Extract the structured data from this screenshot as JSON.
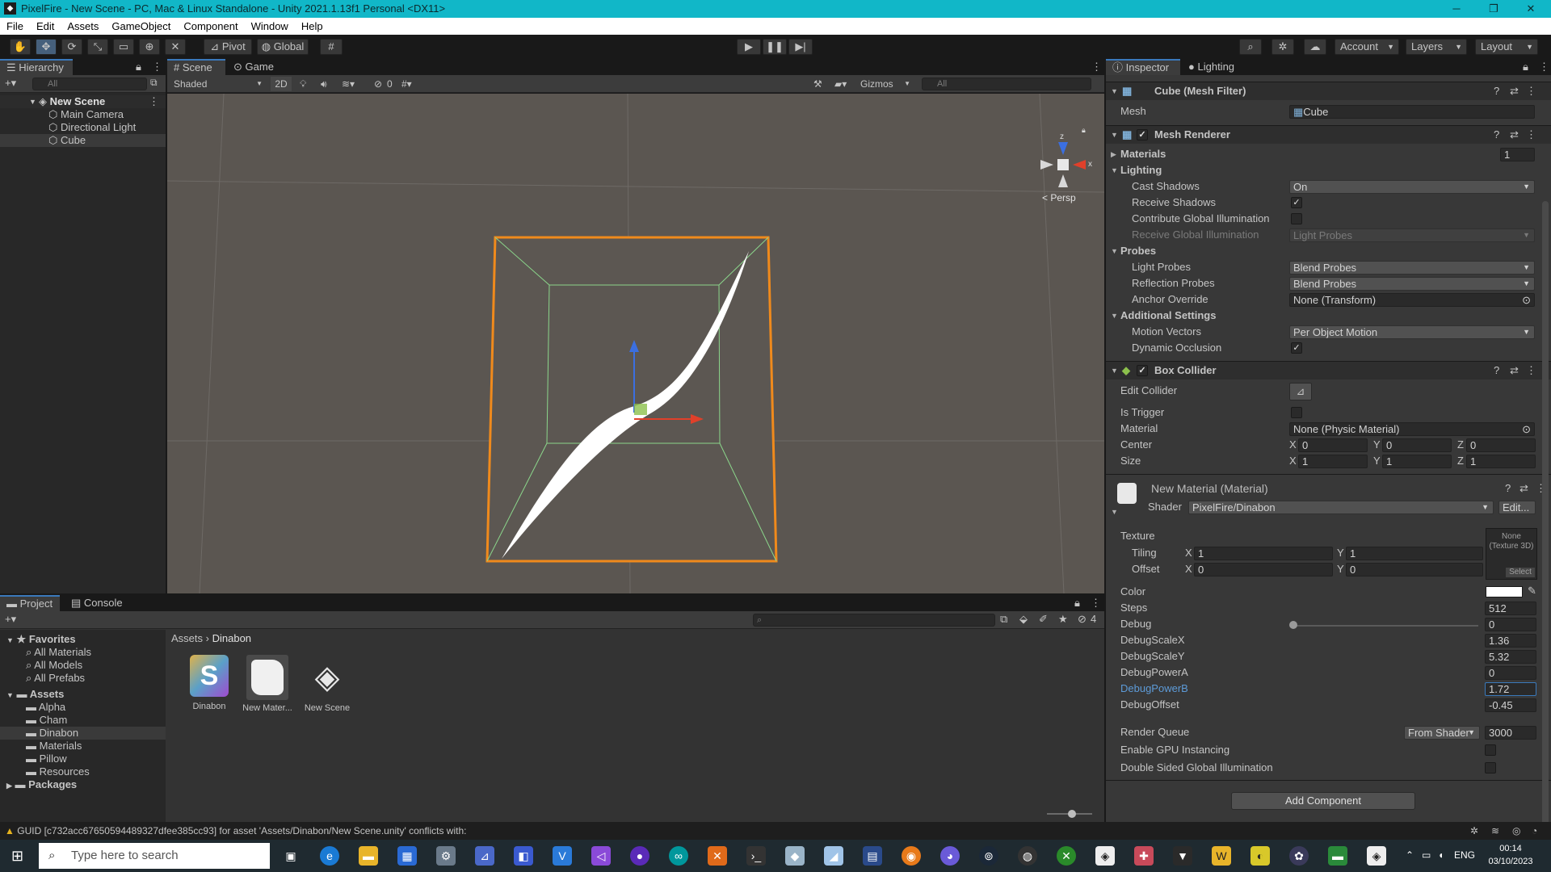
{
  "title": "PixelFire - New Scene - PC, Mac & Linux Standalone - Unity 2021.1.13f1 Personal <DX11>",
  "window_controls": {
    "minimize": "─",
    "maximize": "❐",
    "close": "✕"
  },
  "menu": [
    "File",
    "Edit",
    "Assets",
    "GameObject",
    "Component",
    "Window",
    "Help"
  ],
  "toolbar": {
    "pivot": "Pivot",
    "global": "Global",
    "account": "Account",
    "layers": "Layers",
    "layout": "Layout"
  },
  "hierarchy": {
    "tab": "Hierarchy",
    "search_placeholder": "All",
    "scene": "New Scene",
    "items": [
      "Main Camera",
      "Directional Light",
      "Cube"
    ]
  },
  "scene_view": {
    "tabs": [
      "Scene",
      "Game"
    ],
    "shading": "Shaded",
    "mode_2d": "2D",
    "hidden_count": "0",
    "gizmos": "Gizmos",
    "search_placeholder": "All",
    "persp": "< Persp",
    "axis_z": "z",
    "axis_x": "x"
  },
  "inspector": {
    "tabs": [
      "Inspector",
      "Lighting"
    ],
    "mesh_filter": {
      "title": "Cube (Mesh Filter)",
      "mesh_label": "Mesh",
      "mesh_value": "Cube"
    },
    "mesh_renderer": {
      "title": "Mesh Renderer",
      "materials_label": "Materials",
      "materials_count": "1",
      "lighting": "Lighting",
      "cast_shadows_label": "Cast Shadows",
      "cast_shadows_value": "On",
      "receive_shadows_label": "Receive Shadows",
      "contribute_gi_label": "Contribute Global Illumination",
      "receive_gi_label": "Receive Global Illumination",
      "receive_gi_value": "Light Probes",
      "probes": "Probes",
      "light_probes_label": "Light Probes",
      "light_probes_value": "Blend Probes",
      "reflection_probes_label": "Reflection Probes",
      "reflection_probes_value": "Blend Probes",
      "anchor_override_label": "Anchor Override",
      "anchor_override_value": "None (Transform)",
      "additional": "Additional Settings",
      "motion_vectors_label": "Motion Vectors",
      "motion_vectors_value": "Per Object Motion",
      "dynamic_occlusion_label": "Dynamic Occlusion"
    },
    "box_collider": {
      "title": "Box Collider",
      "edit_collider": "Edit Collider",
      "is_trigger": "Is Trigger",
      "material_label": "Material",
      "material_value": "None (Physic Material)",
      "center_label": "Center",
      "center": {
        "x": "0",
        "y": "0",
        "z": "0"
      },
      "size_label": "Size",
      "size": {
        "x": "1",
        "y": "1",
        "z": "1"
      }
    },
    "material": {
      "title": "New Material (Material)",
      "shader_label": "Shader",
      "shader_value": "PixelFire/Dinabon",
      "edit": "Edit...",
      "texture_label": "Texture",
      "texture_none": "None",
      "texture_type": "(Texture 3D)",
      "select": "Select",
      "tiling_label": "Tiling",
      "tiling": {
        "x": "1",
        "y": "1"
      },
      "offset_label": "Offset",
      "offset": {
        "x": "0",
        "y": "0"
      },
      "color_label": "Color",
      "color_value": "#ffffff",
      "steps_label": "Steps",
      "steps_value": "512",
      "debug_label": "Debug",
      "debug_value": "0",
      "debug_scale_x_label": "DebugScaleX",
      "debug_scale_x_value": "1.36",
      "debug_scale_y_label": "DebugScaleY",
      "debug_scale_y_value": "5.32",
      "debug_power_a_label": "DebugPowerA",
      "debug_power_a_value": "0",
      "debug_power_b_label": "DebugPowerB",
      "debug_power_b_value": "1.72",
      "debug_offset_label": "DebugOffset",
      "debug_offset_value": "-0.45",
      "render_queue_label": "Render Queue",
      "render_queue_mode": "From Shader",
      "render_queue_value": "3000",
      "gpu_instancing_label": "Enable GPU Instancing",
      "double_sided_gi_label": "Double Sided Global Illumination"
    },
    "add_component": "Add Component",
    "vec_labels": {
      "x": "X",
      "y": "Y",
      "z": "Z"
    }
  },
  "project": {
    "tabs": [
      "Project",
      "Console"
    ],
    "favorites": "Favorites",
    "fav_items": [
      "All Materials",
      "All Models",
      "All Prefabs"
    ],
    "assets": "Assets",
    "asset_folders": [
      "Alpha",
      "Cham",
      "Dinabon",
      "Materials",
      "Pillow",
      "Resources"
    ],
    "packages": "Packages",
    "breadcrumb": [
      "Assets",
      "Dinabon"
    ],
    "files": [
      {
        "name": "Dinabon",
        "glyph": "S"
      },
      {
        "name": "New Mater...",
        "glyph": ""
      },
      {
        "name": "New Scene",
        "glyph": ""
      }
    ],
    "hidden_count": "4"
  },
  "status": "GUID [c732acc67650594489327dfee385cc93] for asset 'Assets/Dinabon/New Scene.unity' conflicts with:",
  "taskbar": {
    "search_placeholder": "Type here to search",
    "lang": "ENG",
    "time": "00:14",
    "date": "03/10/2023"
  },
  "colors": {
    "accent": "#11b7c8",
    "selection": "#3a79bb",
    "cube_outline": "#f08a1c",
    "collider": "#8bd68b"
  }
}
